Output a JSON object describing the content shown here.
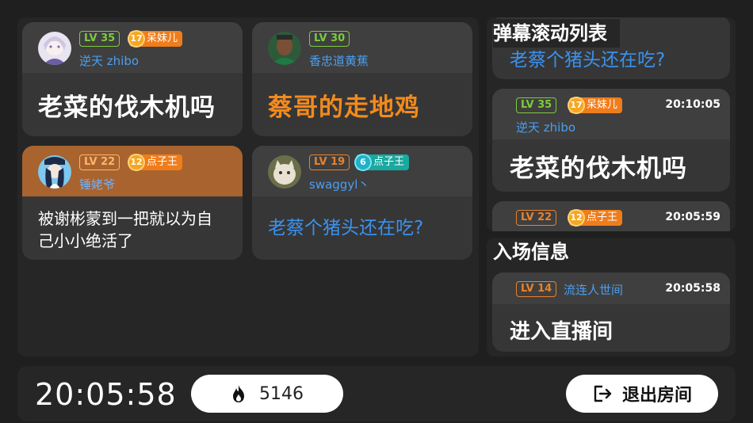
{
  "main_cards": [
    {
      "level": "LV 35",
      "fan_level": "17",
      "fan_name": "呆妹儿",
      "username": "逆天 zhibo",
      "message": "老菜的伐木机吗"
    },
    {
      "level": "LV 30",
      "username": "香忠道黄蕉",
      "message": "蔡哥的走地鸡"
    },
    {
      "level": "LV 22",
      "fan_level": "12",
      "fan_name": "点子王",
      "username": "锤姥爷",
      "message": "被谢彬蒙到一把就以为自己小小绝活了"
    },
    {
      "level": "LV 19",
      "fan_level": "6",
      "fan_name": "点子王",
      "username": "swaggyl丶",
      "message": "老蔡个猪头还在吃?"
    }
  ],
  "danmaku": {
    "title": "弹幕滚动列表",
    "partial_top_message": "老蔡个猪头还在吃?",
    "cards": [
      {
        "level": "LV 35",
        "fan_level": "17",
        "fan_name": "呆妹儿",
        "time": "20:10:05",
        "username": "逆天 zhibo",
        "message": "老菜的伐木机吗"
      },
      {
        "level": "LV 22",
        "fan_level": "12",
        "fan_name": "点子王",
        "time": "20:05:59"
      }
    ]
  },
  "entry": {
    "title": "入场信息",
    "level": "LV 14",
    "username": "流连人世间",
    "time": "20:05:58",
    "message": "进入直播间"
  },
  "footer": {
    "clock": "20:05:58",
    "popularity": "5146",
    "exit_label": "退出房间"
  },
  "colors": {
    "level_green": "#7ccc3d",
    "level_orange": "#e8822c",
    "username_blue": "#4b9ef0",
    "highlight_head": "#a9632e",
    "fan_orange": "#f07d1b",
    "fan_teal": "#19a9a0"
  },
  "icons": [
    "flame-icon",
    "exit-icon"
  ]
}
